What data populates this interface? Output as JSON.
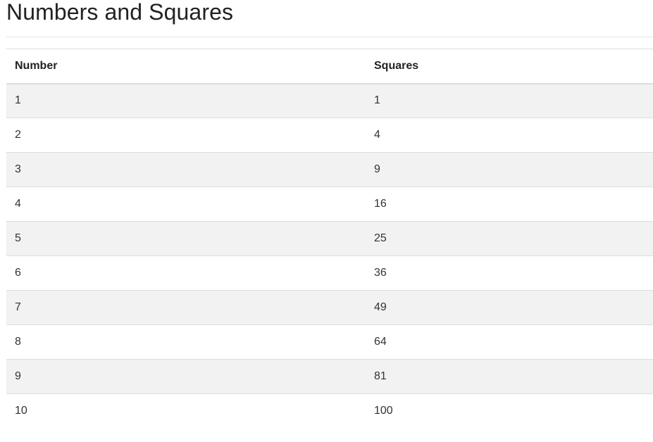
{
  "page": {
    "title": "Numbers and Squares"
  },
  "table": {
    "headers": {
      "number": "Number",
      "squares": "Squares"
    },
    "rows": [
      {
        "number": "1",
        "square": "1"
      },
      {
        "number": "2",
        "square": "4"
      },
      {
        "number": "3",
        "square": "9"
      },
      {
        "number": "4",
        "square": "16"
      },
      {
        "number": "5",
        "square": "25"
      },
      {
        "number": "6",
        "square": "36"
      },
      {
        "number": "7",
        "square": "49"
      },
      {
        "number": "8",
        "square": "64"
      },
      {
        "number": "9",
        "square": "81"
      },
      {
        "number": "10",
        "square": "100"
      }
    ]
  },
  "colors": {
    "stripe": "#f2f2f2",
    "border": "#dddddd",
    "text": "#333333"
  }
}
